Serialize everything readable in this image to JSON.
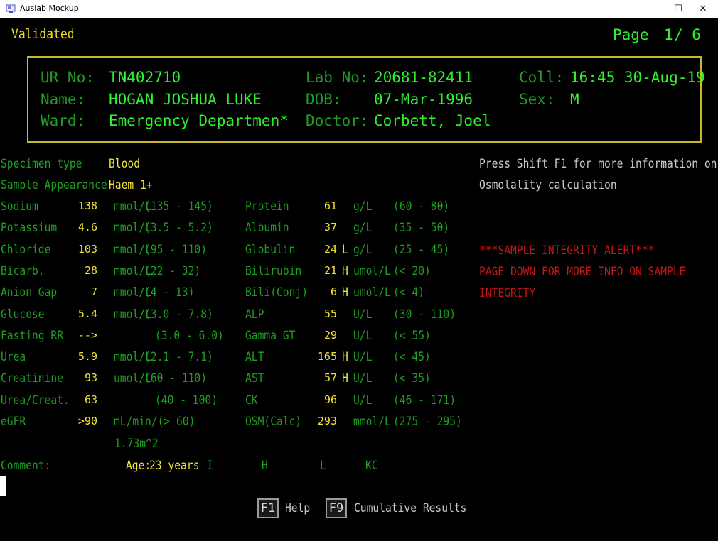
{
  "window": {
    "title": "Auslab Mockup",
    "minimize": "—",
    "maximize": "☐",
    "close": "✕"
  },
  "status": "Validated",
  "page": {
    "label": "Page",
    "current": "1",
    "total": "/ 6"
  },
  "patient": {
    "ur_label": "UR No:",
    "ur": "TN402710",
    "name_label": "Name:",
    "name": "HOGAN JOSHUA LUKE",
    "ward_label": "Ward:",
    "ward": "Emergency Departmen*",
    "lab_label": "Lab No:",
    "lab": "20681-82411",
    "dob_label": "DOB:",
    "dob": "07-Mar-1996",
    "doctor_label": "Doctor:",
    "doctor": "Corbett, Joel",
    "coll_label": "Coll:",
    "coll": "16:45 30-Aug-19",
    "sex_label": "Sex:",
    "sex": "M"
  },
  "specimen": {
    "type_label": "Specimen type",
    "type": "Blood",
    "appearance_label": "Sample Appearance",
    "appearance": "Haem 1+"
  },
  "left_results": [
    {
      "name": "Sodium",
      "value": "138",
      "flag": "",
      "unit": "mmol/L",
      "range": "(135 - 145)"
    },
    {
      "name": "Potassium",
      "value": "4.6",
      "flag": "",
      "unit": "mmol/L",
      "range": "(3.5 - 5.2)"
    },
    {
      "name": "Chloride",
      "value": "103",
      "flag": "",
      "unit": "mmol/L",
      "range": "(95 - 110)"
    },
    {
      "name": "Bicarb.",
      "value": "28",
      "flag": "",
      "unit": "mmol/L",
      "range": "(22 - 32)"
    },
    {
      "name": "Anion Gap",
      "value": "7",
      "flag": "",
      "unit": "mmol/L",
      "range": "(4 - 13)"
    },
    {
      "name": "Glucose",
      "value": "5.4",
      "flag": "",
      "unit": "mmol/L",
      "range": "(3.0 - 7.8)"
    },
    {
      "name": "Fasting RR",
      "value": "-->",
      "flag": "",
      "unit": "",
      "range": "(3.0 - 6.0)"
    },
    {
      "name": "Urea",
      "value": "5.9",
      "flag": "",
      "unit": "mmol/L",
      "range": "(2.1 - 7.1)"
    },
    {
      "name": "Creatinine",
      "value": "93",
      "flag": "",
      "unit": "umol/L",
      "range": "(60 - 110)"
    },
    {
      "name": "Urea/Creat.",
      "value": "63",
      "flag": "",
      "unit": "",
      "range": "(40 - 100)"
    },
    {
      "name": "eGFR",
      "value": ">90",
      "flag": "",
      "unit": "mL/min/(> 60)",
      "range": ""
    }
  ],
  "egfr_unit_line2": "1.73m^2",
  "right_results": [
    {
      "name": "Protein",
      "value": "61",
      "flag": "",
      "unit": "g/L",
      "range": "(60 - 80)"
    },
    {
      "name": "Albumin",
      "value": "37",
      "flag": "",
      "unit": "g/L",
      "range": "(35 - 50)"
    },
    {
      "name": "Globulin",
      "value": "24",
      "flag": "L",
      "unit": "g/L",
      "range": "(25 - 45)"
    },
    {
      "name": "Bilirubin",
      "value": "21",
      "flag": "H",
      "unit": "umol/L",
      "range": "(< 20)"
    },
    {
      "name": "Bili(Conj)",
      "value": "6",
      "flag": "H",
      "unit": "umol/L",
      "range": "(< 4)"
    },
    {
      "name": "ALP",
      "value": "55",
      "flag": "",
      "unit": "U/L",
      "range": "(30 - 110)"
    },
    {
      "name": "Gamma GT",
      "value": "29",
      "flag": "",
      "unit": "U/L",
      "range": "(< 55)"
    },
    {
      "name": "ALT",
      "value": "165",
      "flag": "H",
      "unit": "U/L",
      "range": "(< 45)"
    },
    {
      "name": "AST",
      "value": "57",
      "flag": "H",
      "unit": "U/L",
      "range": "(< 35)"
    },
    {
      "name": "CK",
      "value": "96",
      "flag": "",
      "unit": "U/L",
      "range": "(46 - 171)"
    },
    {
      "name": "OSM(Calc)",
      "value": "293",
      "flag": "",
      "unit": "mmol/L",
      "range": "(275 - 295)"
    }
  ],
  "info": {
    "line1": "Press Shift F1 for more information on",
    "line2": "Osmolality calculation"
  },
  "alert": {
    "line1": "***SAMPLE INTEGRITY ALERT***",
    "line2": "PAGE DOWN FOR MORE INFO ON SAMPLE",
    "line3": "INTEGRITY"
  },
  "comment": {
    "label": "Comment:",
    "age_label": "Age:",
    "age": "23 years",
    "i": "I",
    "h": "H",
    "l": "L",
    "kc": "KC"
  },
  "fkeys": [
    {
      "key": "F1",
      "label": "Help"
    },
    {
      "key": "F9",
      "label": "Cumulative Results"
    }
  ]
}
